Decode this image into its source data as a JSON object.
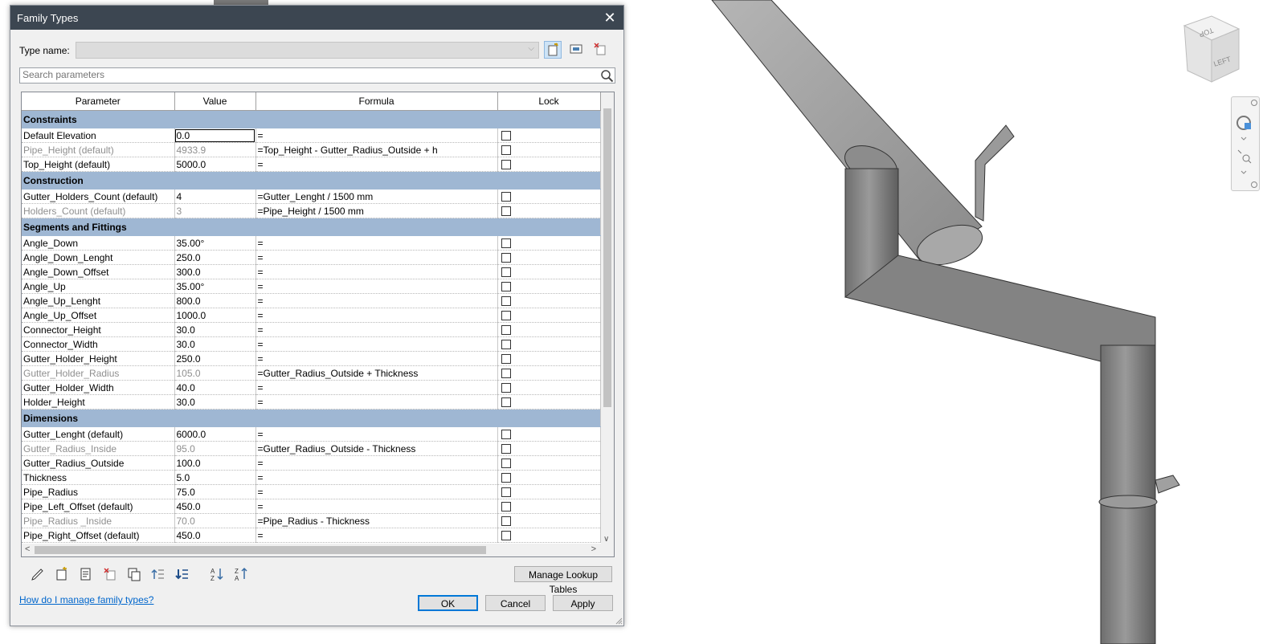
{
  "dialog": {
    "title": "Family Types",
    "type_name_label": "Type name:",
    "type_name_value": "",
    "search_placeholder": "Search parameters",
    "columns": [
      "Parameter",
      "Value",
      "Formula",
      "Lock"
    ],
    "groups": [
      {
        "name": "Constraints",
        "rows": [
          {
            "param": "Default Elevation",
            "value": "0.0",
            "formula": "=",
            "dim": false,
            "selected": true
          },
          {
            "param": "Pipe_Height (default)",
            "value": "4933.9",
            "formula": "=Top_Height - Gutter_Radius_Outside + h",
            "dim": true
          },
          {
            "param": "Top_Height (default)",
            "value": "5000.0",
            "formula": "=",
            "dim": false
          }
        ]
      },
      {
        "name": "Construction",
        "rows": [
          {
            "param": "Gutter_Holders_Count (default)",
            "value": "4",
            "formula": "=Gutter_Lenght / 1500 mm",
            "dim": false
          },
          {
            "param": "Holders_Count (default)",
            "value": "3",
            "formula": "=Pipe_Height / 1500 mm",
            "dim": true
          }
        ]
      },
      {
        "name": "Segments and Fittings",
        "rows": [
          {
            "param": "Angle_Down",
            "value": "35.00°",
            "formula": "=",
            "dim": false
          },
          {
            "param": "Angle_Down_Lenght",
            "value": "250.0",
            "formula": "=",
            "dim": false
          },
          {
            "param": "Angle_Down_Offset",
            "value": "300.0",
            "formula": "=",
            "dim": false
          },
          {
            "param": "Angle_Up",
            "value": "35.00°",
            "formula": "=",
            "dim": false
          },
          {
            "param": "Angle_Up_Lenght",
            "value": "800.0",
            "formula": "=",
            "dim": false
          },
          {
            "param": "Angle_Up_Offset",
            "value": "1000.0",
            "formula": "=",
            "dim": false
          },
          {
            "param": "Connector_Height",
            "value": "30.0",
            "formula": "=",
            "dim": false
          },
          {
            "param": "Connector_Width",
            "value": "30.0",
            "formula": "=",
            "dim": false
          },
          {
            "param": "Gutter_Holder_Height",
            "value": "250.0",
            "formula": "=",
            "dim": false
          },
          {
            "param": "Gutter_Holder_Radius",
            "value": "105.0",
            "formula": "=Gutter_Radius_Outside + Thickness",
            "dim": true
          },
          {
            "param": "Gutter_Holder_Width",
            "value": "40.0",
            "formula": "=",
            "dim": false
          },
          {
            "param": "Holder_Height",
            "value": "30.0",
            "formula": "=",
            "dim": false
          }
        ]
      },
      {
        "name": "Dimensions",
        "rows": [
          {
            "param": "Gutter_Lenght (default)",
            "value": "6000.0",
            "formula": "=",
            "dim": false
          },
          {
            "param": "Gutter_Radius_Inside",
            "value": "95.0",
            "formula": "=Gutter_Radius_Outside - Thickness",
            "dim": true
          },
          {
            "param": "Gutter_Radius_Outside",
            "value": "100.0",
            "formula": "=",
            "dim": false
          },
          {
            "param": "Thickness",
            "value": "5.0",
            "formula": "=",
            "dim": false
          },
          {
            "param": "Pipe_Radius",
            "value": "75.0",
            "formula": "=",
            "dim": false
          },
          {
            "param": "Pipe_Left_Offset (default)",
            "value": "450.0",
            "formula": "=",
            "dim": false
          },
          {
            "param": "Pipe_Radius _Inside",
            "value": "70.0",
            "formula": "=Pipe_Radius - Thickness",
            "dim": true
          },
          {
            "param": "Pipe_Right_Offset (default)",
            "value": "450.0",
            "formula": "=",
            "dim": false
          }
        ]
      }
    ],
    "manage_lookup_label": "Manage Lookup Tables",
    "help_link": "How do I manage family types?",
    "ok_label": "OK",
    "cancel_label": "Cancel",
    "apply_label": "Apply"
  },
  "viewcube": {
    "top_label": "TOP",
    "left_label": "LEFT"
  }
}
